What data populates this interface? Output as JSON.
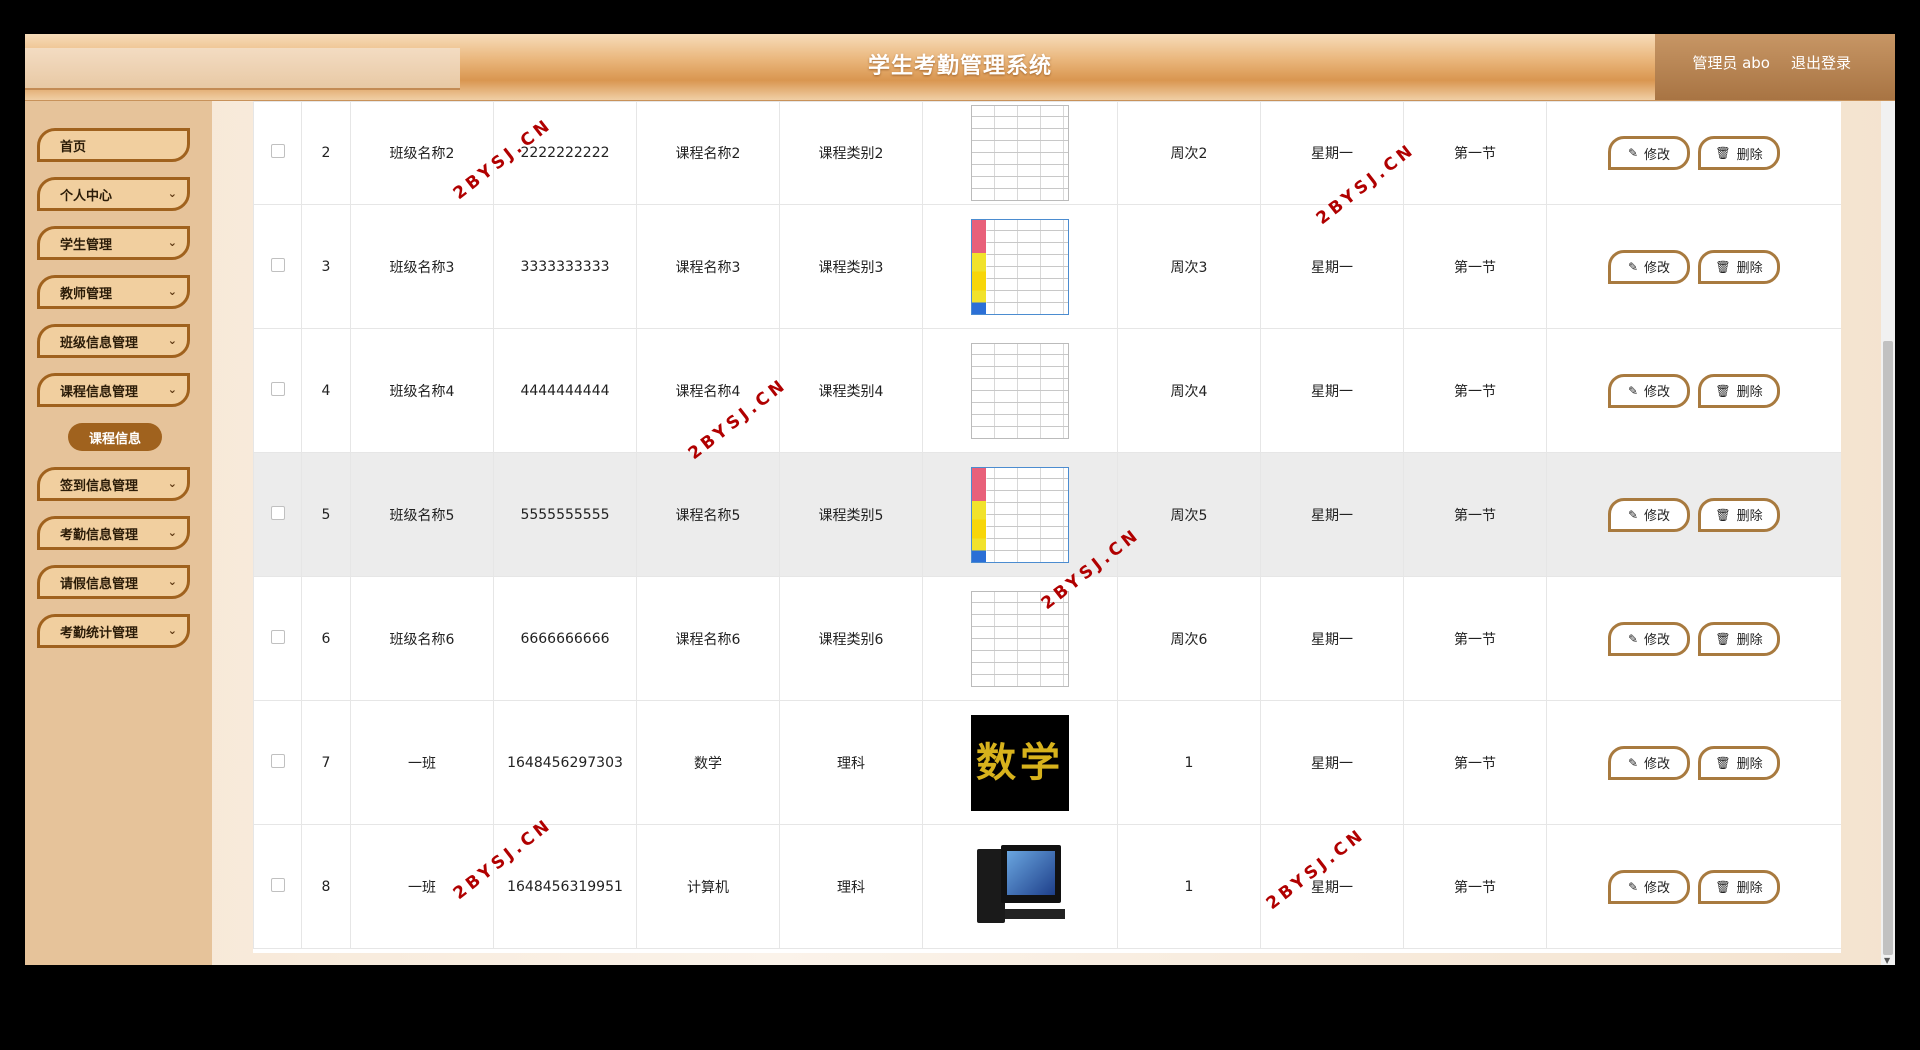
{
  "header": {
    "title": "学生考勤管理系统",
    "user": "管理员 abo",
    "logout": "退出登录"
  },
  "sidebar": {
    "items": [
      {
        "label": "首页",
        "chevron": false
      },
      {
        "label": "个人中心",
        "chevron": true
      },
      {
        "label": "学生管理",
        "chevron": true
      },
      {
        "label": "教师管理",
        "chevron": true
      },
      {
        "label": "班级信息管理",
        "chevron": true
      },
      {
        "label": "课程信息管理",
        "chevron": true
      },
      {
        "label": "签到信息管理",
        "chevron": true
      },
      {
        "label": "考勤信息管理",
        "chevron": true
      },
      {
        "label": "请假信息管理",
        "chevron": true
      },
      {
        "label": "考勤统计管理",
        "chevron": true
      }
    ],
    "submenu": "课程信息"
  },
  "table": {
    "rows": [
      {
        "index": "2",
        "class_name": "班级名称2",
        "course_no": "2222222222",
        "course_name": "课程名称2",
        "course_type": "课程类别2",
        "image": "doc",
        "week": "周次2",
        "weekday": "星期一",
        "section": "第一节"
      },
      {
        "index": "3",
        "class_name": "班级名称3",
        "course_no": "3333333333",
        "course_name": "课程名称3",
        "course_type": "课程类别3",
        "image": "colorful",
        "week": "周次3",
        "weekday": "星期一",
        "section": "第一节"
      },
      {
        "index": "4",
        "class_name": "班级名称4",
        "course_no": "4444444444",
        "course_name": "课程名称4",
        "course_type": "课程类别4",
        "image": "doc",
        "week": "周次4",
        "weekday": "星期一",
        "section": "第一节"
      },
      {
        "index": "5",
        "class_name": "班级名称5",
        "course_no": "5555555555",
        "course_name": "课程名称5",
        "course_type": "课程类别5",
        "image": "colorful",
        "week": "周次5",
        "weekday": "星期一",
        "section": "第一节"
      },
      {
        "index": "6",
        "class_name": "班级名称6",
        "course_no": "6666666666",
        "course_name": "课程名称6",
        "course_type": "课程类别6",
        "image": "doc",
        "week": "周次6",
        "weekday": "星期一",
        "section": "第一节"
      },
      {
        "index": "7",
        "class_name": "一班",
        "course_no": "1648456297303",
        "course_name": "数学",
        "course_type": "理科",
        "image": "shuxue",
        "week": "1",
        "weekday": "星期一",
        "section": "第一节"
      },
      {
        "index": "8",
        "class_name": "一班",
        "course_no": "1648456319951",
        "course_name": "计算机",
        "course_type": "理科",
        "image": "pc",
        "week": "1",
        "weekday": "星期一",
        "section": "第一节"
      }
    ],
    "edit_label": "修改",
    "delete_label": "删除",
    "image_text_shuxue": "数学",
    "highlighted_row_index": "5"
  },
  "watermark": "2BYSJ.CN",
  "colors": {
    "accent": "#a0621e",
    "button_border": "#a87a3f",
    "sidebar_bg": "#e6c39a",
    "watermark": "#b00000"
  }
}
